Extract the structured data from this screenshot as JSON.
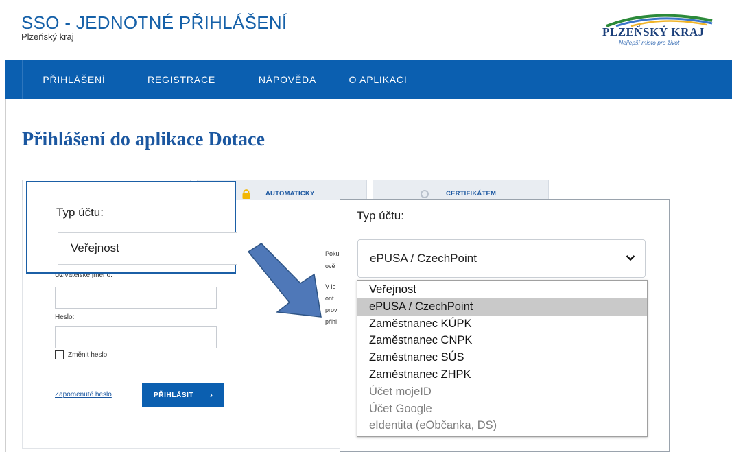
{
  "header": {
    "title": "SSO - JEDNOTNÉ PŘIHLÁŠENÍ",
    "subtitle": "Plzeňský kraj",
    "logo_text": "PLZEŇSKÝ KRAJ",
    "logo_tagline": "Nejlepší místo pro život"
  },
  "nav": {
    "items": [
      {
        "label": "PŘIHLÁŠENÍ"
      },
      {
        "label": "REGISTRACE"
      },
      {
        "label": "NÁPOVĚDA"
      },
      {
        "label": "O APLIKACI"
      }
    ]
  },
  "page": {
    "title": "Přihlášení do aplikace Dotace"
  },
  "tabs": {
    "automatic": "AUTOMATICKY",
    "certificate": "CERTIFIKÁTEM"
  },
  "form": {
    "username_label": "Uživatelské jméno:",
    "password_label": "Heslo:",
    "change_password_label": "Změnit heslo",
    "forgot_password": "Zapomenuté heslo",
    "login_button": "PŘIHLÁSIT",
    "login_arrow": "›",
    "info_lines": [
      "Poku",
      "ově",
      "V le",
      "ont",
      "prov",
      "přihl"
    ]
  },
  "callout_small": {
    "label": "Typ účtu:",
    "value": "Veřejnost"
  },
  "callout_big": {
    "label": "Typ účtu:",
    "selected_value": "ePUSA / CzechPoint",
    "options": [
      {
        "label": "Veřejnost",
        "state": "normal"
      },
      {
        "label": "ePUSA / CzechPoint",
        "state": "selected"
      },
      {
        "label": "Zaměstnanec KÚPK",
        "state": "normal"
      },
      {
        "label": "Zaměstnanec CNPK",
        "state": "normal"
      },
      {
        "label": "Zaměstnanec SÚS",
        "state": "normal"
      },
      {
        "label": "Zaměstnanec ZHPK",
        "state": "normal"
      },
      {
        "label": "Účet mojeID",
        "state": "disabled"
      },
      {
        "label": "Účet Google",
        "state": "disabled"
      },
      {
        "label": "eIdentita (eObčanka, DS)",
        "state": "disabled"
      }
    ]
  },
  "colors": {
    "brand_blue": "#0b5fb0",
    "heading_blue": "#1b57a0",
    "arrow_fill": "#4f78b8",
    "selected_option": "#c9c9c9"
  }
}
